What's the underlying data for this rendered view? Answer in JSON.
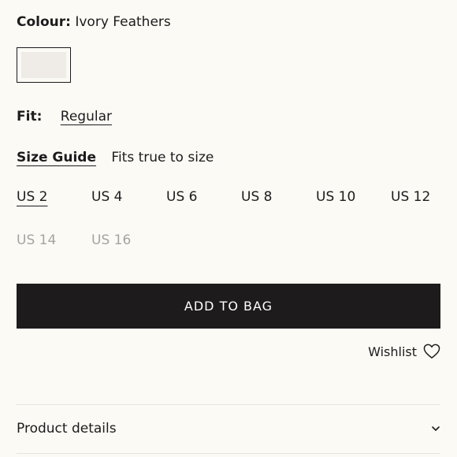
{
  "colour": {
    "label": "Colour:",
    "value": "Ivory Feathers",
    "swatch_color": "#efebe6"
  },
  "fit": {
    "label": "Fit:",
    "value": "Regular"
  },
  "size_guide": {
    "link": "Size Guide",
    "note": "Fits true to size"
  },
  "sizes": [
    {
      "label": "US 2",
      "state": "selected"
    },
    {
      "label": "US 4",
      "state": "available"
    },
    {
      "label": "US 6",
      "state": "available"
    },
    {
      "label": "US 8",
      "state": "available"
    },
    {
      "label": "US 10",
      "state": "available"
    },
    {
      "label": "US 12",
      "state": "available"
    },
    {
      "label": "US 14",
      "state": "unavailable"
    },
    {
      "label": "US 16",
      "state": "unavailable"
    }
  ],
  "add_to_bag": {
    "label": "ADD TO BAG"
  },
  "wishlist": {
    "label": "Wishlist",
    "icon": "heart-icon"
  },
  "product_details": {
    "label": "Product details",
    "icon": "chevron-down-icon"
  },
  "colors": {
    "background": "#fbfaf5",
    "text": "#1d1b1c",
    "button": "#1d1b1c",
    "muted": "#a6a4a1"
  }
}
